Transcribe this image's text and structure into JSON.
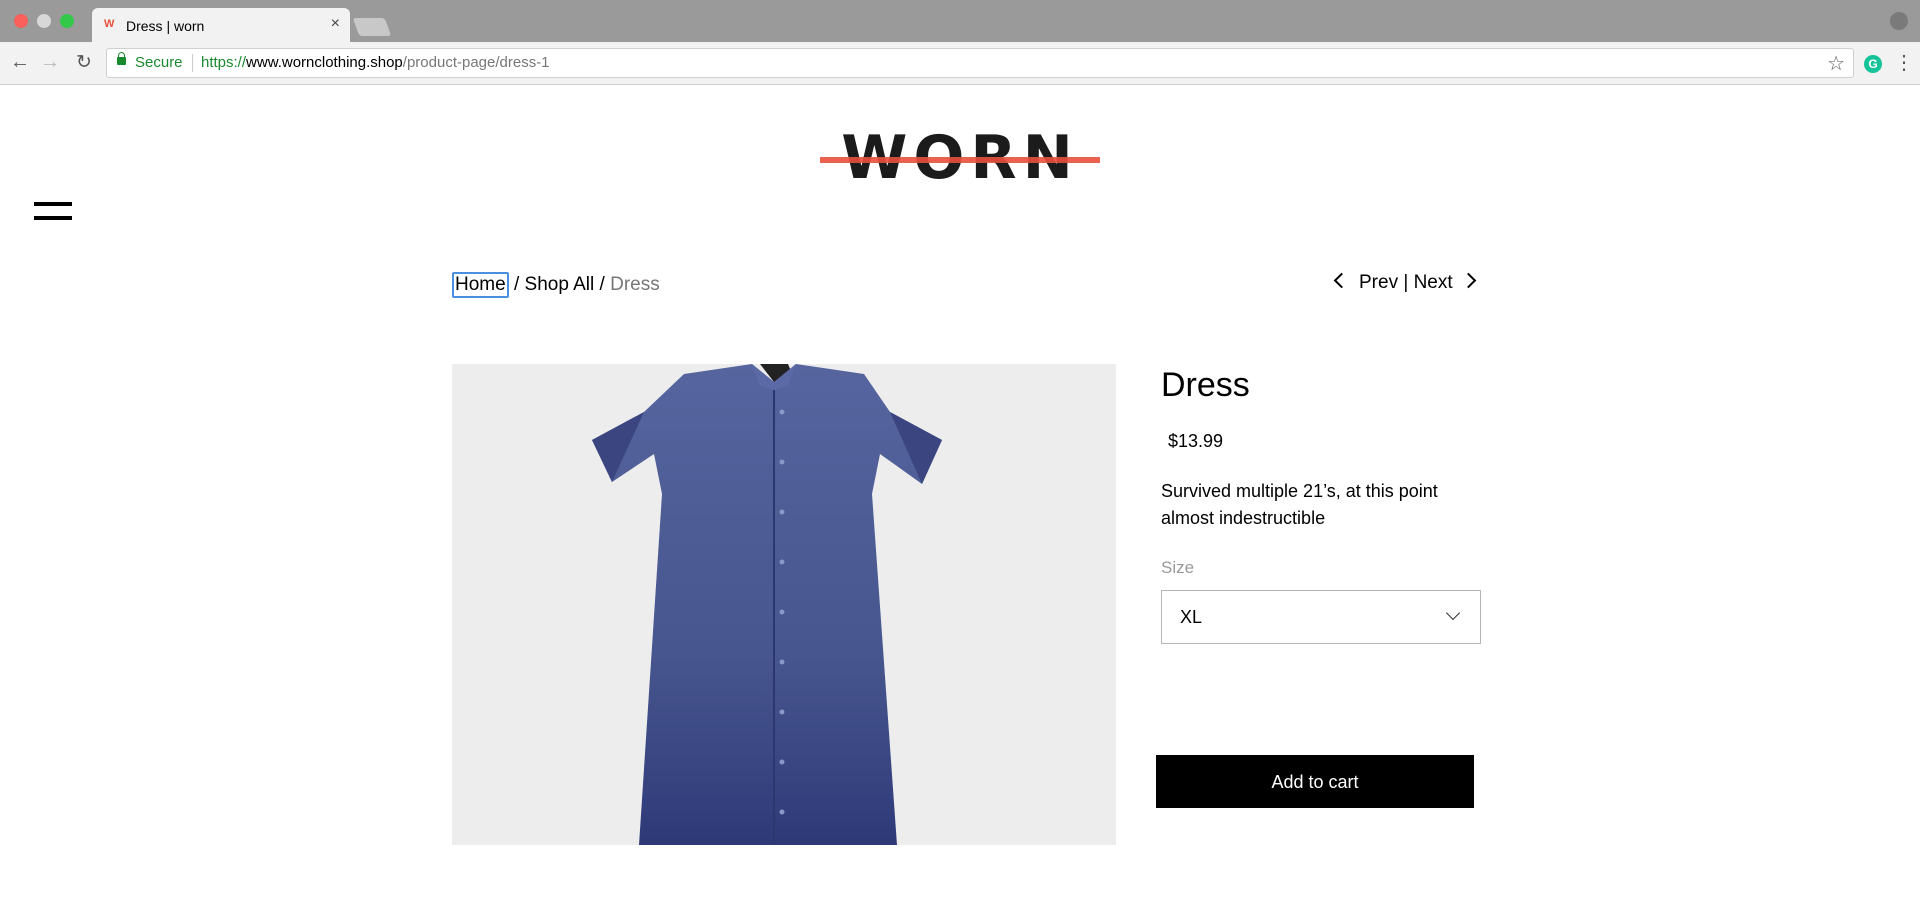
{
  "browser": {
    "tab_title": "Dress | worn",
    "tab_favicon": "W",
    "secure_label": "Secure",
    "url_protocol": "https://",
    "url_host": "www.wornclothing.shop",
    "url_path": "/product-page/dress-1",
    "extension_label": "G"
  },
  "site": {
    "logo_text": "WORN",
    "logo_strike_color": "#e8503a"
  },
  "breadcrumb": {
    "home": "Home",
    "sep1": " / ",
    "shop_all": "Shop All",
    "sep2": " / ",
    "current": "Dress"
  },
  "pager": {
    "prev": "Prev",
    "sep": " | ",
    "next": "Next"
  },
  "product": {
    "title": "Dress",
    "price": "$13.99",
    "description": "Survived multiple 21’s, at this point almost indestructible",
    "size_label": "Size",
    "size_selected": "XL",
    "add_to_cart": "Add to cart",
    "dress_color": "#4b5a9a"
  }
}
